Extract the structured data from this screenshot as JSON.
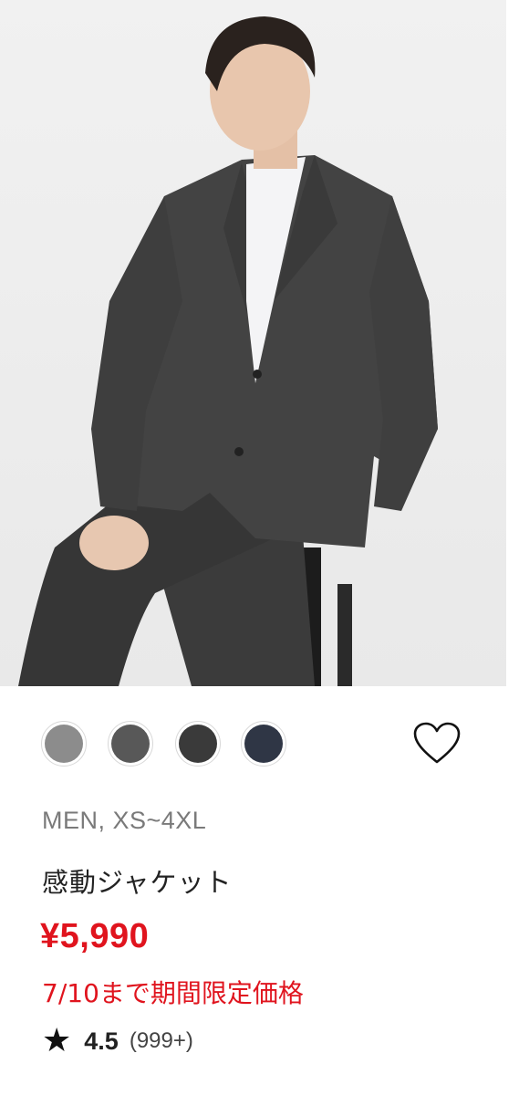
{
  "product": {
    "image_alt": "man wearing dark gray suit jacket",
    "meta": "MEN, XS~4XL",
    "name": "感動ジャケット",
    "price": "¥5,990",
    "promo": "7/10まで期間限定価格",
    "rating": {
      "icon": "star-icon",
      "score": "4.5",
      "count": "(999+)"
    }
  },
  "swatches": [
    {
      "name": "light-gray",
      "color": "#8c8c8c"
    },
    {
      "name": "gray",
      "color": "#585858"
    },
    {
      "name": "dark-gray",
      "color": "#3a3a3a"
    },
    {
      "name": "navy",
      "color": "#2f3645"
    }
  ],
  "favorite": {
    "icon": "heart-icon"
  },
  "colors": {
    "accent_red": "#e0141e",
    "text_dark": "#222222",
    "text_muted": "#7a7a7a"
  }
}
